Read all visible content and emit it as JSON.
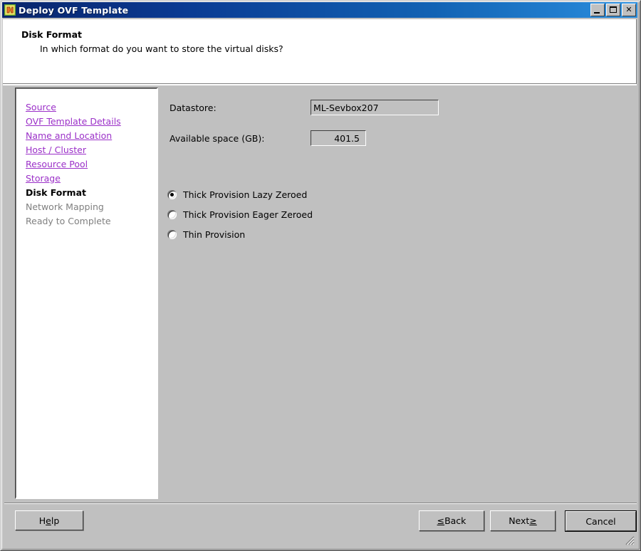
{
  "window": {
    "title": "Deploy OVF Template",
    "icon": "ovf-template-icon",
    "controls": {
      "minimize": "minimize-button",
      "maximize": "maximize-button",
      "close": "✕"
    }
  },
  "header": {
    "title": "Disk Format",
    "subtitle": "In which format do you want to store the virtual disks?"
  },
  "sidebar": {
    "items": [
      {
        "label": "Source",
        "state": "done"
      },
      {
        "label": "OVF Template Details",
        "state": "done"
      },
      {
        "label": "Name and Location",
        "state": "done"
      },
      {
        "label": "Host / Cluster",
        "state": "done"
      },
      {
        "label": "Resource Pool",
        "state": "done"
      },
      {
        "label": "Storage",
        "state": "done"
      },
      {
        "label": "Disk Format",
        "state": "current"
      },
      {
        "label": "Network Mapping",
        "state": "upcoming"
      },
      {
        "label": "Ready to Complete",
        "state": "upcoming"
      }
    ]
  },
  "main": {
    "datastore": {
      "label": "Datastore:",
      "value": "ML-Sevbox207"
    },
    "available_space": {
      "label": "Available space (GB):",
      "value": "401.5"
    },
    "disk_format": {
      "selected": "Thick Provision Lazy Zeroed",
      "options": [
        {
          "label": "Thick Provision Lazy Zeroed",
          "checked": true
        },
        {
          "label": "Thick Provision Eager Zeroed",
          "checked": false
        },
        {
          "label": "Thin Provision",
          "checked": false
        }
      ]
    }
  },
  "footer": {
    "help": {
      "before": "H",
      "mnemonic": "e",
      "after": "lp"
    },
    "back": {
      "before": "≤ ",
      "mnemonic": "",
      "after": "Back"
    },
    "next": {
      "before": "Next ",
      "mnemonic": "≥",
      "after": ""
    },
    "cancel": {
      "before": "Cancel",
      "mnemonic": "",
      "after": ""
    }
  },
  "colors": {
    "face": "#c0c0c0",
    "titlebar_left": "#09246b",
    "titlebar_right": "#2a8ede",
    "link": "#9b30c8",
    "disabled_text": "#808080",
    "field_bg": "#c0c0c0"
  }
}
